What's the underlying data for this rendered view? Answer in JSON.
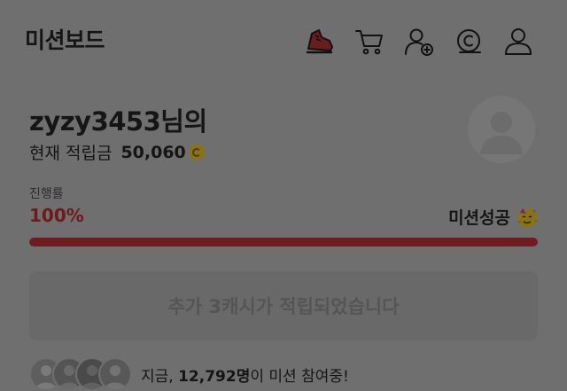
{
  "header": {
    "title": "미션보드",
    "icons": [
      "shoe-icon",
      "cart-icon",
      "add-user-icon",
      "coin-icon",
      "profile-icon"
    ]
  },
  "user": {
    "name": "zyzy3453님의",
    "balance_label": "현재 적립금",
    "balance": "50,060"
  },
  "progress": {
    "label": "진행률",
    "value": "100%",
    "fraction": 1.0,
    "status": "미션성공"
  },
  "cta": {
    "label": "추가 3캐시가 적립되었습니다"
  },
  "participants": {
    "prefix": "지금, ",
    "count": "12,792명",
    "suffix": "이 미션 참여중!"
  },
  "colors": {
    "background": "#6f6f6f",
    "accent": "#6e1c1f",
    "coin": "#8a7216"
  }
}
